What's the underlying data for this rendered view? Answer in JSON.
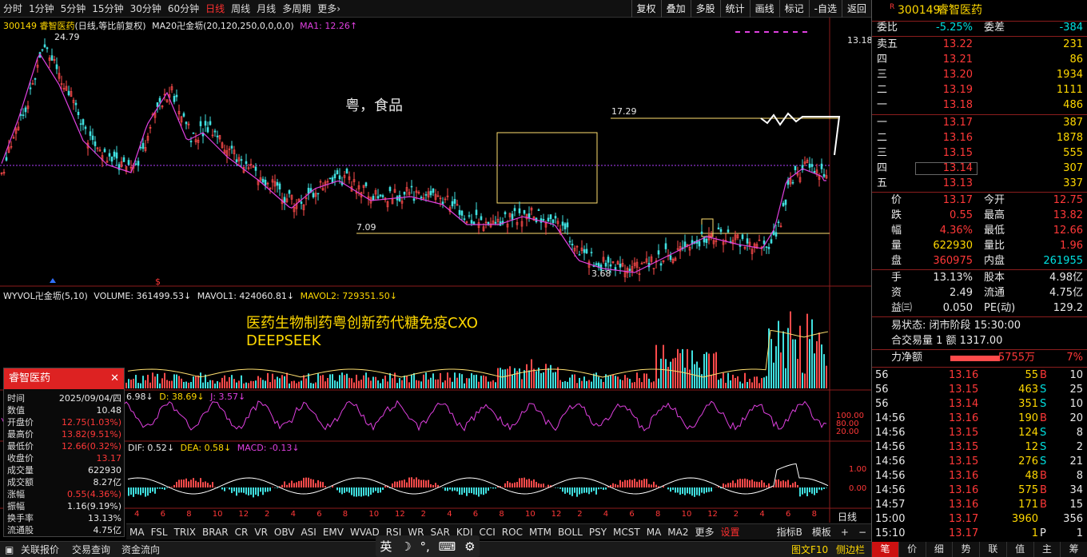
{
  "toolbar": {
    "timeframes": [
      "分时",
      "1分钟",
      "5分钟",
      "15分钟",
      "30分钟",
      "60分钟",
      "日线",
      "周线",
      "月线",
      "多周期",
      "更多›"
    ],
    "active_timeframe": "日线",
    "buttons": [
      "复权",
      "叠加",
      "多股",
      "统计",
      "画线",
      "标记",
      "-自选",
      "返回"
    ]
  },
  "chart": {
    "legend_code": "300149 睿智医药",
    "legend_mode": "(日线,等比前复权)",
    "legend_ma": "MA20卍金坜(20,120,250,0,0,0,0)",
    "legend_ma1": "MA1: 12.26↑",
    "annotation_main": "粤，食品",
    "annotation_volume_1": "医药生物制药粤创新药代糖免疫CXO",
    "annotation_volume_2": "DEEPSEEK",
    "label_high": "24.79",
    "label_low": "3.68",
    "label_line1": "17.29",
    "label_line2": "7.09",
    "axis_top": "13.18",
    "vol_legend": "WYVOL卍金坜(5,10)",
    "vol_volume": "VOLUME: 361499.53↓",
    "vol_mavol1": "MAVOL1: 424060.81↓",
    "vol_mavol2": "MAVOL2: 729351.50↓",
    "kdj_k": "6.98↓",
    "kdj_d": "D: 38.69↓",
    "kdj_j": "J: 3.57↓",
    "kdj_axis": [
      "100.00",
      "80.00",
      "20.00"
    ],
    "macd_dif": "DIF: 0.52↓",
    "macd_dea": "DEA: 0.58↓",
    "macd_macd": "MACD: -0.13↓",
    "macd_axis": [
      "1.00",
      "0.00"
    ],
    "month_ticks": [
      "4",
      "6",
      "8",
      "10",
      "12",
      "2",
      "4",
      "6",
      "8",
      "10",
      "12",
      "2",
      "4",
      "6",
      "8",
      "10",
      "12",
      "2",
      "4",
      "6",
      "8",
      "10",
      "12",
      "2",
      "4",
      "6",
      "8"
    ],
    "period_label": "日线"
  },
  "popup": {
    "title": "睿智医药",
    "rows": [
      {
        "k": "时间",
        "v": "2025/09/04/四",
        "c": "wht"
      },
      {
        "k": "数值",
        "v": "10.48",
        "c": "wht"
      },
      {
        "k": "开盘价",
        "v": "12.75(1.03%)",
        "c": "red"
      },
      {
        "k": "最高价",
        "v": "13.82(9.51%)",
        "c": "red"
      },
      {
        "k": "最低价",
        "v": "12.66(0.32%)",
        "c": "red"
      },
      {
        "k": "收盘价",
        "v": "13.17",
        "c": "red"
      },
      {
        "k": "成交量",
        "v": "622930",
        "c": "wht"
      },
      {
        "k": "成交额",
        "v": "8.27亿",
        "c": "wht"
      },
      {
        "k": "涨幅",
        "v": "0.55(4.36%)",
        "c": "red"
      },
      {
        "k": "振幅",
        "v": "1.16(9.19%)",
        "c": "wht"
      },
      {
        "k": "换手率",
        "v": "13.13%",
        "c": "wht"
      },
      {
        "k": "流通股",
        "v": "4.75亿",
        "c": "wht"
      }
    ]
  },
  "indicator_tabs": [
    "MA",
    "FSL",
    "TRIX",
    "BRAR",
    "CR",
    "VR",
    "OBV",
    "ASI",
    "EMV",
    "WVAD",
    "RSI",
    "WR",
    "SAR",
    "KDJ",
    "CCI",
    "ROC",
    "MTM",
    "BOLL",
    "PSY",
    "MCST",
    "MA",
    "MA2",
    "更多",
    "设置"
  ],
  "indicator_tabs_right": [
    "指标B",
    "模板",
    "+",
    "−"
  ],
  "status": {
    "left": [
      "关联报价",
      "交易查询",
      "资金流向"
    ],
    "right1": "图文F10",
    "right2": "侧边栏"
  },
  "ime": [
    "英",
    "☽",
    "°,",
    "⌨",
    "⚙"
  ],
  "quote": {
    "code": "300149",
    "name": "睿智医药",
    "wb_label": "委比",
    "wb": "-5.25%",
    "wc_label": "委差",
    "wc": "-384",
    "asks": [
      {
        "l": "卖五",
        "p": "13.22",
        "v": "231"
      },
      {
        "l": "四",
        "p": "13.21",
        "v": "86"
      },
      {
        "l": "三",
        "p": "13.20",
        "v": "1934"
      },
      {
        "l": "二",
        "p": "13.19",
        "v": "1111"
      },
      {
        "l": "一",
        "p": "13.18",
        "v": "486"
      }
    ],
    "bids": [
      {
        "l": "一",
        "p": "13.17",
        "v": "387"
      },
      {
        "l": "二",
        "p": "13.16",
        "v": "1878"
      },
      {
        "l": "三",
        "p": "13.15",
        "v": "555"
      },
      {
        "l": "四",
        "p": "13.14",
        "v": "307"
      },
      {
        "l": "五",
        "p": "13.13",
        "v": "337"
      }
    ],
    "stats": [
      {
        "l1": "价",
        "v1": "13.17",
        "c1": "red",
        "l2": "今开",
        "v2": "12.75",
        "c2": "red"
      },
      {
        "l1": "跌",
        "v1": "0.55",
        "c1": "red",
        "l2": "最高",
        "v2": "13.82",
        "c2": "red"
      },
      {
        "l1": "幅",
        "v1": "4.36%",
        "c1": "red",
        "l2": "最低",
        "v2": "12.66",
        "c2": "red"
      },
      {
        "l1": "量",
        "v1": "622930",
        "c1": "yel",
        "l2": "量比",
        "v2": "1.96",
        "c2": "red"
      },
      {
        "l1": "盘",
        "v1": "360975",
        "c1": "red",
        "l2": "内盘",
        "v2": "261955",
        "c2": "grn"
      }
    ],
    "stats2": [
      {
        "l1": "手",
        "v1": "13.13%",
        "l2": "股本",
        "v2": "4.98亿"
      },
      {
        "l1": "资",
        "v1": "2.49",
        "l2": "流通",
        "v2": "4.75亿"
      },
      {
        "l1": "益㈢",
        "v1": "0.050",
        "l2": "PE(动)",
        "v2": "129.2"
      }
    ],
    "phase": "易状态: 闭市阶段 15:30:00",
    "auction": "合交易量 1 额 1317.00",
    "netflow_label": "力净额",
    "netflow": "5755万",
    "netflow_pct": "7%",
    "ticks": [
      {
        "t": "56",
        "p": "13.16",
        "v": "55",
        "s": "B",
        "n": "10"
      },
      {
        "t": "56",
        "p": "13.15",
        "v": "463",
        "s": "S",
        "n": "25"
      },
      {
        "t": "56",
        "p": "13.14",
        "v": "351",
        "s": "S",
        "n": "10"
      },
      {
        "t": "14:56",
        "p": "13.16",
        "v": "190",
        "s": "B",
        "n": "20"
      },
      {
        "t": "14:56",
        "p": "13.15",
        "v": "124",
        "s": "S",
        "n": "8"
      },
      {
        "t": "14:56",
        "p": "13.15",
        "v": "12",
        "s": "S",
        "n": "2"
      },
      {
        "t": "14:56",
        "p": "13.15",
        "v": "276",
        "s": "S",
        "n": "21"
      },
      {
        "t": "14:56",
        "p": "13.16",
        "v": "48",
        "s": "B",
        "n": "8"
      },
      {
        "t": "14:56",
        "p": "13.16",
        "v": "575",
        "s": "B",
        "n": "34"
      },
      {
        "t": "14:57",
        "p": "13.16",
        "v": "171",
        "s": "B",
        "n": "15"
      },
      {
        "t": "15:00",
        "p": "13.17",
        "v": "3960",
        "s": "",
        "n": "356"
      },
      {
        "t": "15:10",
        "p": "13.17",
        "v": "1",
        "s": "P",
        "n": "1"
      }
    ],
    "tabs": [
      "笔",
      "价",
      "细",
      "势",
      "联",
      "值",
      "主",
      "筹"
    ]
  }
}
